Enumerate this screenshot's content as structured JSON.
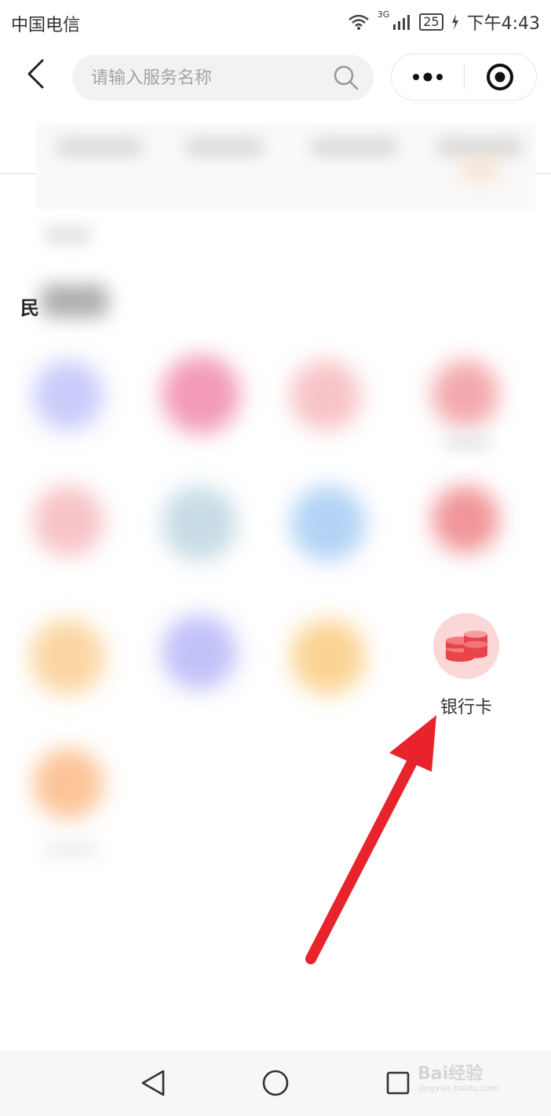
{
  "status_bar": {
    "carrier": "中国电信",
    "network": "3G",
    "battery": "25",
    "time": "下午4:43"
  },
  "header": {
    "search_placeholder": "请输入服务名称"
  },
  "section": {
    "title_partial": "民"
  },
  "tiles": [
    {
      "label": "银行卡",
      "icon": "coins-stack-icon",
      "color": "#e8454a"
    }
  ],
  "watermark": {
    "text": "Bai经验",
    "sub": "jingyan.baidu.com"
  },
  "colors": {
    "arrow": "#e8232c",
    "icon_bg": "#fbd7d7"
  }
}
